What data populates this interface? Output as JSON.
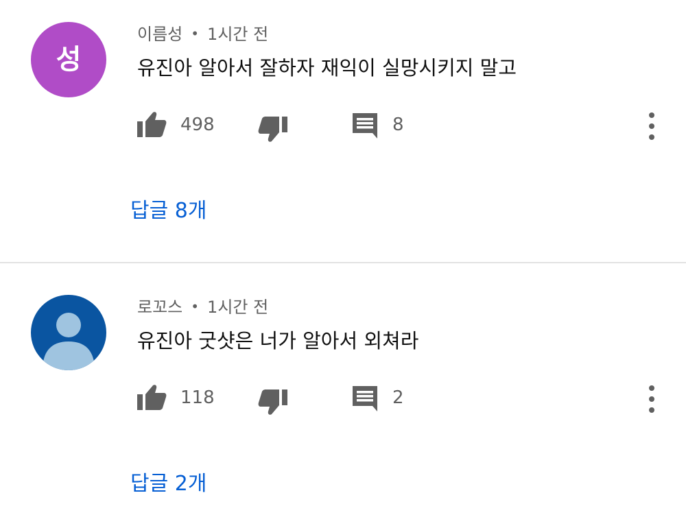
{
  "comments": [
    {
      "author": "이름성",
      "separator": "•",
      "time": "1시간 전",
      "avatar": {
        "type": "letter",
        "letter": "성",
        "color": "#b04cc7"
      },
      "text": "유진아 알아서 잘하자 재익이 실망시키지 말고",
      "likes": "498",
      "reply_count": "8",
      "replies_link": "답글 8개",
      "icons": [
        "thumb-up-icon",
        "thumb-down-icon",
        "reply-comment-icon",
        "more-vert-icon"
      ]
    },
    {
      "author": "로꼬스",
      "separator": "•",
      "time": "1시간 전",
      "avatar": {
        "type": "default-silhouette",
        "color": "#0a55a1",
        "figure_color": "#9fc4e0"
      },
      "text": "유진아 굿샷은 너가 알아서 외쳐라",
      "likes": "118",
      "reply_count": "2",
      "replies_link": "답글 2개",
      "icons": [
        "thumb-up-icon",
        "thumb-down-icon",
        "reply-comment-icon",
        "more-vert-icon"
      ]
    }
  ],
  "colors": {
    "meta_text": "#606060",
    "body_text": "#0f0f0f",
    "link": "#065fd4",
    "icon": "#606060",
    "divider": "#e2e2e2"
  }
}
